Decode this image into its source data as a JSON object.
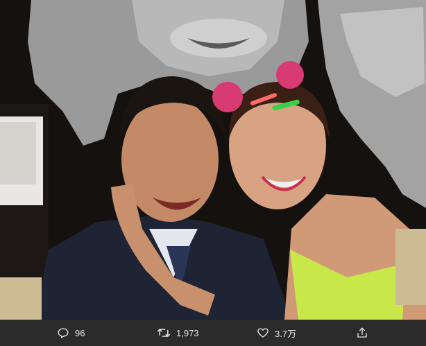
{
  "photo": {
    "alt_subject": "two-people-portrait"
  },
  "actions": {
    "reply_count": "96",
    "retweet_count": "1,973",
    "like_count": "3.7万"
  },
  "colors": {
    "bar_bg": "#2b2b2b",
    "icon": "#e6e6e6"
  }
}
